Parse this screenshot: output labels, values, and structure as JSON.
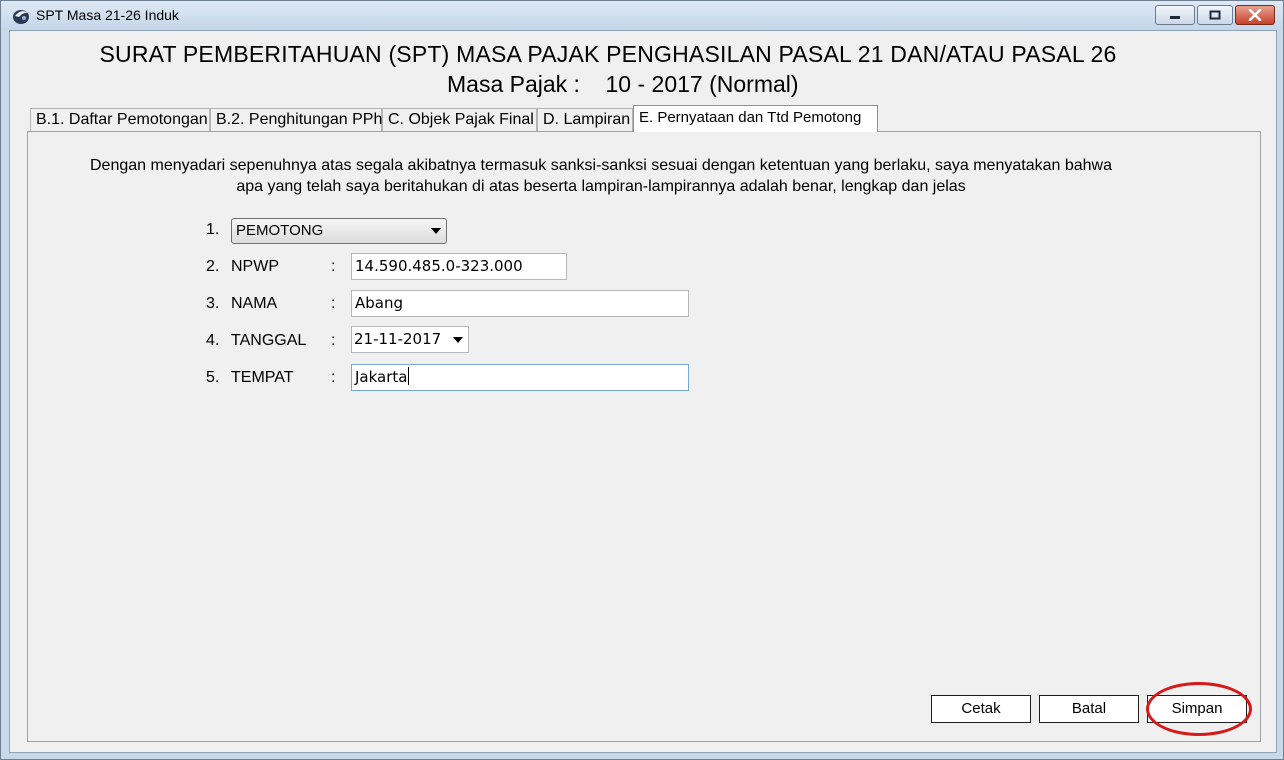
{
  "window": {
    "title": "SPT Masa 21-26 Induk",
    "accent_close": "#c5422b"
  },
  "header": {
    "title": "SURAT PEMBERITAHUAN (SPT) MASA PAJAK PENGHASILAN PASAL 21 DAN/ATAU PASAL 26",
    "masa_label": "Masa Pajak :",
    "masa_value": "10 - 2017 (Normal)"
  },
  "tabs": [
    {
      "label": "B.1. Daftar Pemotongan",
      "active": false
    },
    {
      "label": "B.2. Penghitungan PPh",
      "active": false
    },
    {
      "label": "C. Objek Pajak Final",
      "active": false
    },
    {
      "label": "D. Lampiran",
      "active": false
    },
    {
      "label": "E. Pernyataan dan Ttd Pemotong",
      "active": true
    }
  ],
  "statement": {
    "line1": "Dengan menyadari sepenuhnya atas segala akibatnya termasuk sanksi-sanksi sesuai dengan ketentuan yang berlaku, saya menyatakan bahwa",
    "line2": "apa yang telah saya beritahukan di atas beserta lampiran-lampirannya adalah benar, lengkap dan jelas"
  },
  "form": {
    "row1": {
      "num": "1.",
      "select_value": "PEMOTONG"
    },
    "row2": {
      "num": "2.",
      "label": "NPWP",
      "colon": ":",
      "value": "14.590.485.0-323.000"
    },
    "row3": {
      "num": "3.",
      "label": "NAMA",
      "colon": ":",
      "value": "Abang"
    },
    "row4": {
      "num": "4.",
      "label": "TANGGAL",
      "colon": ":",
      "value": "21-11-2017"
    },
    "row5": {
      "num": "5.",
      "label": "TEMPAT",
      "colon": ":",
      "value": "Jakarta"
    }
  },
  "buttons": {
    "cetak": "Cetak",
    "batal": "Batal",
    "simpan": "Simpan",
    "highlight_color": "#d61a1a"
  }
}
